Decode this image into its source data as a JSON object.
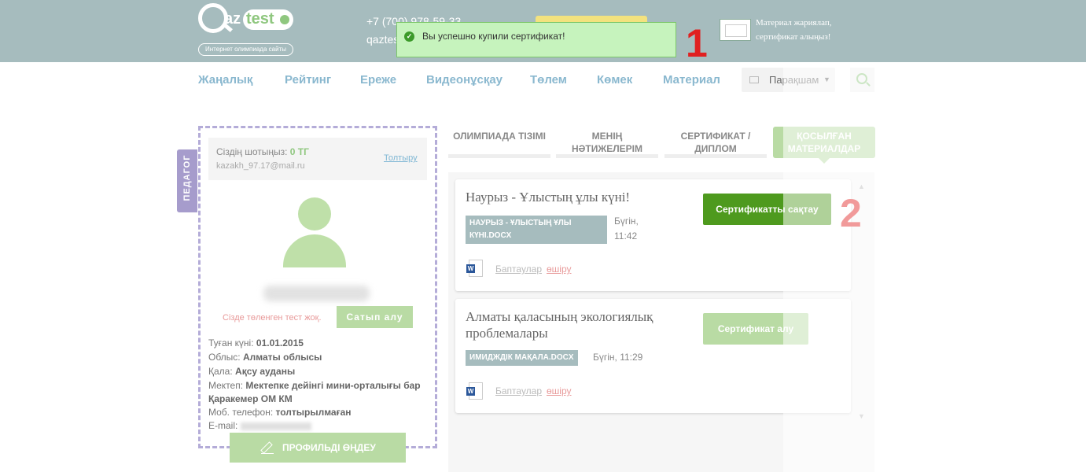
{
  "header": {
    "logo": {
      "az": "az",
      "test": "test",
      "slogan": "Интернет олимпиада сайты"
    },
    "phone": "+7 (700) 978-59-33",
    "email": "qaztes",
    "promo": "Материал жариялап, сертификат алыңыз!"
  },
  "toast": {
    "message": "Вы успешно купили сертификат!"
  },
  "annotations": {
    "first": "1",
    "second": "2"
  },
  "nav": {
    "items": [
      "Жаңалық",
      "Рейтинг",
      "Ереже",
      "Видеонұсқау",
      "Төлем",
      "Көмек",
      "Материал"
    ],
    "profile": "Парақшам"
  },
  "side_tab": "ПЕДАГОГ",
  "profile": {
    "balance_label": "Сіздің шотыңыз:",
    "balance_value": "0 ТГ",
    "email": "kazakh_97.17@mail.ru",
    "topup": "Толтыру",
    "no_tests": "Сізде төленген тест жоқ.",
    "buy": "Сатып алу",
    "details": [
      {
        "label": "Туған күні:",
        "value": "01.01.2015"
      },
      {
        "label": "Облыс:",
        "value": "Алматы облысы"
      },
      {
        "label": "Қала:",
        "value": "Ақсу ауданы"
      },
      {
        "label": "Мектеп:",
        "value": "Мектепке дейінгі мини-орталығы бар Қаракемер ОМ КМ"
      },
      {
        "label": "Моб. телефон:",
        "value": "толтырылмаған"
      },
      {
        "label": "E-mail:",
        "value": ""
      }
    ],
    "edit": "ПРОФИЛЬДІ ӨҢДЕУ"
  },
  "tabs": [
    {
      "label": "ОЛИМПИАДА ТІЗІМІ"
    },
    {
      "label": "МЕНІҢ НӘТИЖЕЛЕРІМ"
    },
    {
      "label": "СЕРТИФИКАТ / ДИПЛОМ"
    },
    {
      "label": "ҚОСЫЛҒАН МАТЕРИАЛДАР"
    }
  ],
  "materials": [
    {
      "title": "Наурыз - Ұлыстың ұлы күні!",
      "file": "НАУРЫЗ - ҰЛЫСТЫҢ ҰЛЫ КҮНІ.DOCX",
      "date": "Бүгін, 11:42",
      "options": "Баптаулар",
      "delete": "өшіру",
      "action": "Сертификатты сақтау"
    },
    {
      "title": "Алматы қаласының экологиялық проблемалары",
      "file": "ИМИДЖДІК МАҚАЛА.DOCX",
      "date": "Бүгін, 11:29",
      "options": "Баптаулар",
      "delete": "өшіру",
      "action": "Сертификат алу"
    }
  ],
  "colors": {
    "header": "#a6bcbe",
    "accent": "#8fc77f",
    "dark_green": "#4e9a1e",
    "annotation": "#e02020"
  }
}
